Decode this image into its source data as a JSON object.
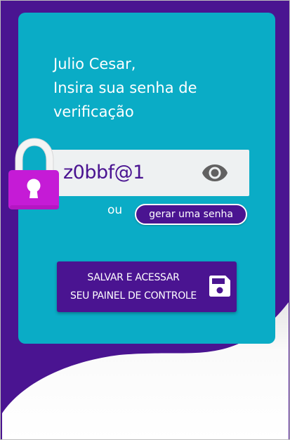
{
  "greeting": {
    "line1": "Julio Cesar,",
    "line2": "Insira sua senha de",
    "line3": "verificação"
  },
  "password": {
    "value": "z0bbf@1"
  },
  "icons": {
    "lock": "lock-icon",
    "visibility": "eye-icon",
    "save": "floppy-disk-icon"
  },
  "or_label": "ou",
  "generate_button_label": "gerar uma senha",
  "save_button": {
    "line1": "SALVAR E ACESSAR",
    "line2": "SEU PAINEL DE CONTROLE"
  },
  "colors": {
    "purple": "#4a1491",
    "teal": "#0aacc6",
    "lock_magenta": "#c51bd6",
    "input_bg": "#eef1f2"
  }
}
